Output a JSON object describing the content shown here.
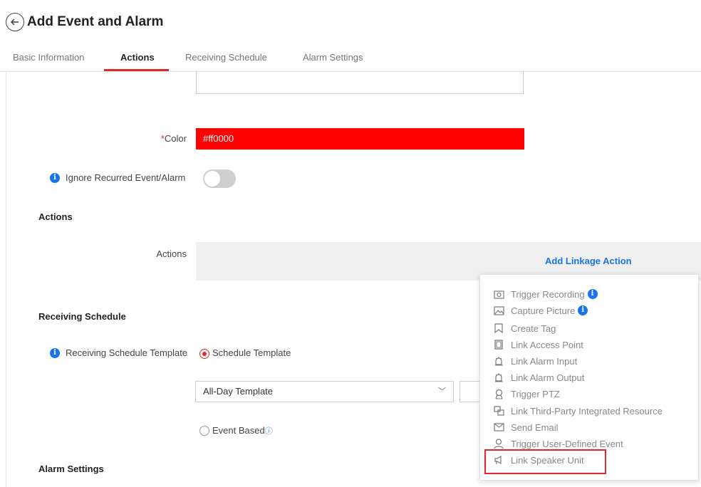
{
  "header": {
    "title": "Add Event and Alarm",
    "tabs": [
      {
        "label": "Basic Information"
      },
      {
        "label": "Actions"
      },
      {
        "label": "Receiving Schedule"
      },
      {
        "label": "Alarm Settings"
      }
    ],
    "active_tab": "Actions"
  },
  "form": {
    "color": {
      "required_mark": "*",
      "label": "Color",
      "value": "#ff0000"
    },
    "ignore_recurred": {
      "label": "Ignore Recurred Event/Alarm",
      "enabled": false
    },
    "actions_section_title": "Actions",
    "actions_label": "Actions",
    "add_linkage_action": "Add Linkage Action",
    "receiving_schedule_section_title": "Receiving Schedule",
    "schedule_template_label": "Receiving Schedule Template",
    "schedule_template_option": "Schedule Template",
    "template_select_value": "All-Day Template",
    "event_based_option": "Event Based",
    "alarm_settings_section_title": "Alarm Settings"
  },
  "linkage_menu": {
    "items": [
      {
        "label": "Trigger Recording",
        "icon": "camera-icon",
        "info": true
      },
      {
        "label": "Capture Picture",
        "icon": "picture-icon",
        "info": true
      },
      {
        "label": "Create Tag",
        "icon": "bookmark-icon",
        "info": false
      },
      {
        "label": "Link Access Point",
        "icon": "door-icon",
        "info": false
      },
      {
        "label": "Link Alarm Input",
        "icon": "alarm-input-icon",
        "info": false
      },
      {
        "label": "Link Alarm Output",
        "icon": "alarm-output-icon",
        "info": false
      },
      {
        "label": "Trigger PTZ",
        "icon": "ptz-icon",
        "info": false
      },
      {
        "label": "Link Third-Party Integrated Resource",
        "icon": "third-party-icon",
        "info": false
      },
      {
        "label": "Send Email",
        "icon": "email-icon",
        "info": false
      },
      {
        "label": "Trigger User-Defined Event",
        "icon": "user-icon",
        "info": false
      },
      {
        "label": "Link Speaker Unit",
        "icon": "speaker-icon",
        "info": false
      }
    ],
    "highlighted_item": "Link Speaker Unit"
  },
  "colors": {
    "accent": "#e0272a",
    "link": "#1a73e8",
    "color_value": "#ff0000"
  }
}
